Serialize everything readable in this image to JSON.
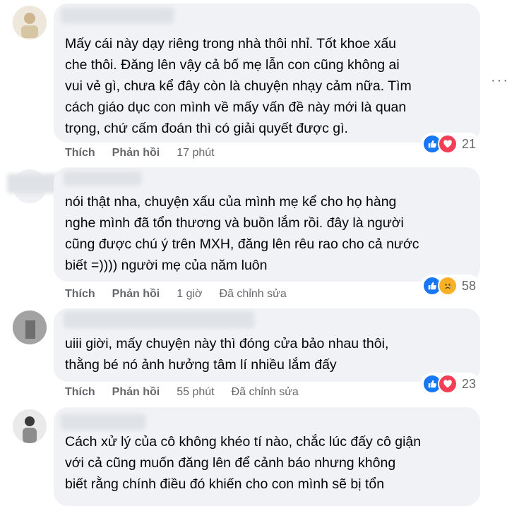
{
  "comments": [
    {
      "text": "Mấy cái này dạy riêng trong nhà thôi nhỉ. Tốt khoe xấu\nche thôi. Đăng lên vậy cả bố mẹ lẫn con cũng không ai\nvui vẻ gì, chưa kể đây còn là chuyện nhạy cảm nữa. Tìm\ncách giáo dục con mình về mấy vấn đề này mới là quan\ntrọng, chứ cấm đoán thì có giải quyết được gì.",
      "like_label": "Thích",
      "reply_label": "Phản hồi",
      "time": "17 phút",
      "edited": "",
      "reaction_count": "21",
      "reactions": [
        "like-icon",
        "love-icon"
      ]
    },
    {
      "text": "nói thật nha, chuyện xấu của mình mẹ kể cho họ hàng\nnghe mình đã tổn thương và buồn lắm rồi. đây là người\ncũng được chú ý trên MXH, đăng lên rêu rao cho cả nước\nbiết =)))) người mẹ của năm luôn",
      "like_label": "Thích",
      "reply_label": "Phản hồi",
      "time": "1 giờ",
      "edited": "Đã chỉnh sửa",
      "reaction_count": "58",
      "reactions": [
        "like-icon",
        "sad-icon"
      ]
    },
    {
      "text": "uiii giời, mấy chuyện này thì đóng cửa bảo nhau thôi,\nthằng bé nó ảnh hưởng tâm lí nhiều lắm đấy",
      "like_label": "Thích",
      "reply_label": "Phản hồi",
      "time": "55 phút",
      "edited": "Đã chỉnh sửa",
      "reaction_count": "23",
      "reactions": [
        "like-icon",
        "love-icon"
      ]
    },
    {
      "text": "Cách xử lý của cô không khéo tí nào, chắc lúc đấy cô giận\nvới cả cũng muốn đăng lên để cảnh báo nhưng không\nbiết rằng chính điều đó khiến cho con mình sẽ bị tổn",
      "like_label": "",
      "reply_label": "",
      "time": "",
      "edited": "",
      "reaction_count": "",
      "reactions": []
    }
  ],
  "more_options": "···",
  "colors": {
    "bubble": "#f0f2f5",
    "like": "#1877f2",
    "love": "#f33e58",
    "sad": "#f7b125",
    "meta": "#65676b"
  }
}
